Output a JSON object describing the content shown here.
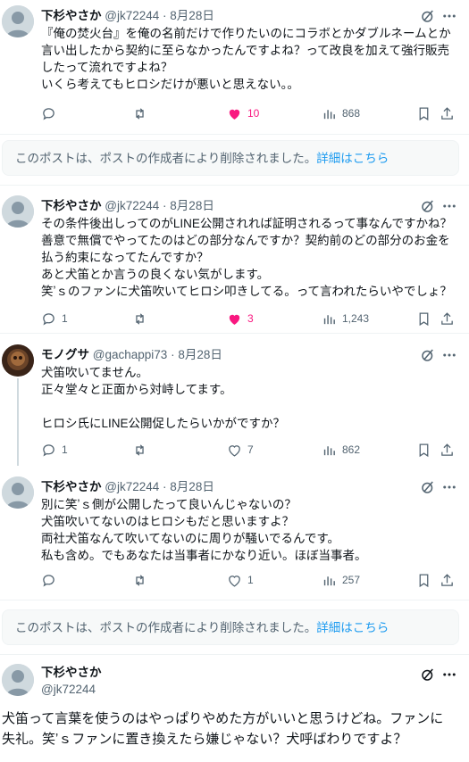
{
  "tweets": [
    {
      "name": "下杉やさか",
      "handle": "@jk72244",
      "dot": "·",
      "date": "8月28日",
      "lines": [
        "『俺の焚火台』を俺の名前だけで作りたいのにコラボとかダブルネームとか",
        "言い出したから契約に至らなかったんですよね？って改良を加えて強行販売",
        "したって流れですよね？",
        "いくら考えてもヒロシだけが悪いと思えない。。"
      ],
      "replies": "",
      "retweets": "",
      "likes": "10",
      "views": "868"
    },
    {
      "name": "下杉やさか",
      "handle": "@jk72244",
      "dot": "·",
      "date": "8月28日",
      "lines": [
        "その条件後出しってのがLINE公開されれば証明されるって事なんですかね？",
        "善意で無償でやってたのはどの部分なんですか？契約前のどの部分のお金を",
        "払う約束になってたんですか？",
        "あと犬笛とか言うの良くない気がします。",
        "笑ʼｓのファンに犬笛吹いてヒロシ叩きしてる。って言われたらいやでしょ？"
      ],
      "replies": "1",
      "retweets": "",
      "likes": "3",
      "views": "1,243"
    },
    {
      "name": "モノグサ",
      "handle": "@gachappi73",
      "dot": "·",
      "date": "8月28日",
      "lines": [
        "犬笛吹いてません。",
        "正々堂々と正面から対峙してます。",
        "",
        "ヒロシ氏にLINE公開促したらいかがですか？"
      ],
      "replies": "1",
      "retweets": "",
      "likes": "7",
      "views": "862"
    },
    {
      "name": "下杉やさか",
      "handle": "@jk72244",
      "dot": "·",
      "date": "8月28日",
      "lines": [
        "別に笑ʼｓ側が公開したって良いんじゃないの？",
        "犬笛吹いてないのはヒロシもだと思いますよ？",
        "両社犬笛なんて吹いてないのに周りが騒いでるんです。",
        "私も含め。でもあなたは当事者にかなり近い。ほぼ当事者。"
      ],
      "replies": "",
      "retweets": "",
      "likes": "1",
      "views": "257"
    }
  ],
  "deleted_notice": {
    "text": "このポストは、ポストの作成者により削除されました。",
    "link": "詳細はこちら"
  },
  "main_tweet": {
    "name": "下杉やさか",
    "handle": "@jk72244",
    "lines": [
      "犬笛って言葉を使うのはやっぱりやめた方がいいと思うけどね。ファンに",
      "失礼。笑ʼｓファンに置き換えたら嫌じゃない？犬呼ばわりですよ？"
    ]
  },
  "colors": {
    "like_active": "#f91880",
    "link": "#1d9bf0",
    "muted": "#536471"
  },
  "icons": [
    "reply-icon",
    "retweet-icon",
    "like-icon",
    "views-icon",
    "bookmark-icon",
    "share-icon",
    "grok-icon",
    "more-icon"
  ]
}
